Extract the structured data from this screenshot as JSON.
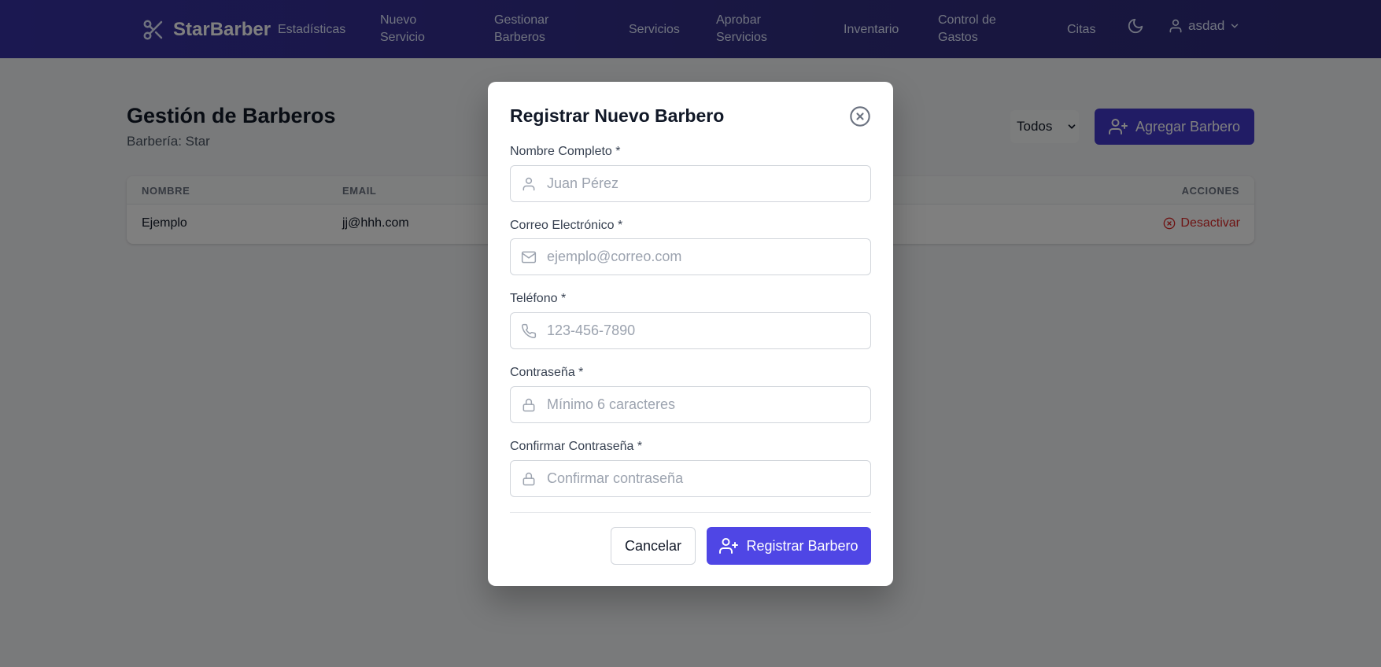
{
  "navbar": {
    "brand": "StarBarber",
    "items": [
      {
        "line1": "Estadísticas",
        "line2": ""
      },
      {
        "line1": "Nuevo",
        "line2": "Servicio"
      },
      {
        "line1": "Gestionar",
        "line2": "Barberos"
      },
      {
        "line1": "Servicios",
        "line2": ""
      },
      {
        "line1": "Aprobar",
        "line2": "Servicios"
      },
      {
        "line1": "Inventario",
        "line2": ""
      },
      {
        "line1": "Control de",
        "line2": "Gastos"
      },
      {
        "line1": "Citas",
        "line2": ""
      }
    ],
    "user": "asdad",
    "icons": {
      "brand": "scissors-icon",
      "theme": "moon-icon",
      "user": "user-icon",
      "dropdown": "chevron-down-icon"
    }
  },
  "page": {
    "title": "Gestión de Barberos",
    "subtitle": "Barbería: Star",
    "filter_value": "Todos",
    "add_button": "Agregar Barbero"
  },
  "table": {
    "headers": [
      "NOMBRE",
      "EMAIL",
      "ACCIONES"
    ],
    "rows": [
      {
        "name": "Ejemplo",
        "email": "jj@hhh.com",
        "action": "Desactivar"
      }
    ]
  },
  "modal": {
    "title": "Registrar Nuevo Barbero",
    "fields": [
      {
        "label": "Nombre Completo *",
        "placeholder": "Juan Pérez",
        "value": "",
        "icon": "user-icon"
      },
      {
        "label": "Correo Electrónico *",
        "placeholder": "ejemplo@correo.com",
        "value": "",
        "icon": "mail-icon"
      },
      {
        "label": "Teléfono *",
        "placeholder": "123-456-7890",
        "value": "",
        "icon": "phone-icon"
      },
      {
        "label": "Contraseña *",
        "placeholder": "Mínimo 6 caracteres",
        "value": "",
        "icon": "lock-icon"
      },
      {
        "label": "Confirmar Contraseña *",
        "placeholder": "Confirmar contraseña",
        "value": "",
        "icon": "lock-icon"
      }
    ],
    "cancel": "Cancelar",
    "submit": "Registrar Barbero"
  },
  "colors": {
    "nav": "#3730a3",
    "primary": "#4f46e5",
    "danger": "#dc2626"
  }
}
